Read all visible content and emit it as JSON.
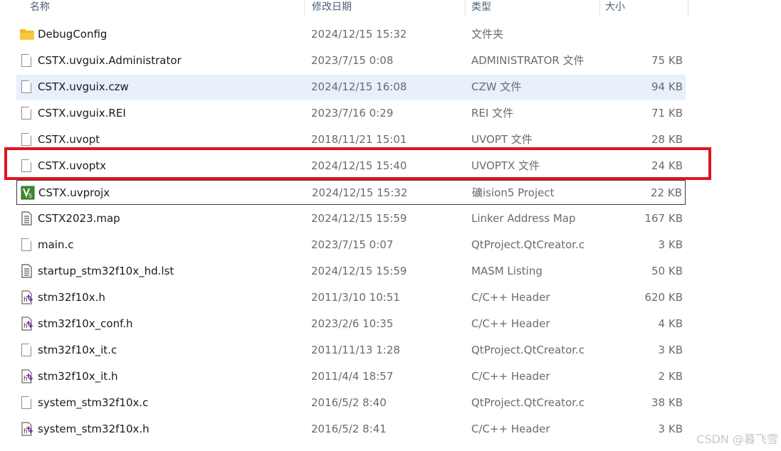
{
  "columns": {
    "name": "名称",
    "date": "修改日期",
    "type": "类型",
    "size": "大小"
  },
  "files": [
    {
      "name": "DebugConfig",
      "date": "2024/12/15 15:32",
      "type": "文件夹",
      "size": "",
      "icon": "folder-icon"
    },
    {
      "name": "CSTX.uvguix.Administrator",
      "date": "2023/7/15 0:08",
      "type": "ADMINISTRATOR 文件",
      "size": "75 KB",
      "icon": "file-icon"
    },
    {
      "name": "CSTX.uvguix.czw",
      "date": "2024/12/15 16:08",
      "type": "CZW 文件",
      "size": "94 KB",
      "icon": "file-icon",
      "selected": true
    },
    {
      "name": "CSTX.uvguix.REI",
      "date": "2023/7/16 0:29",
      "type": "REI 文件",
      "size": "71 KB",
      "icon": "file-icon"
    },
    {
      "name": "CSTX.uvopt",
      "date": "2018/11/21 15:01",
      "type": "UVOPT 文件",
      "size": "28 KB",
      "icon": "file-icon"
    },
    {
      "name": "CSTX.uvoptx",
      "date": "2024/12/15 15:40",
      "type": "UVOPTX 文件",
      "size": "24 KB",
      "icon": "file-icon",
      "highlighted": true
    },
    {
      "name": "CSTX.uvprojx",
      "date": "2024/12/15 15:32",
      "type": "礦ision5 Project",
      "size": "22 KB",
      "icon": "keil-project-icon",
      "focused": true
    },
    {
      "name": "CSTX2023.map",
      "date": "2024/12/15 15:59",
      "type": "Linker Address Map",
      "size": "167 KB",
      "icon": "text-file-icon"
    },
    {
      "name": "main.c",
      "date": "2023/7/15 0:07",
      "type": "QtProject.QtCreator.c",
      "size": "3 KB",
      "icon": "file-icon"
    },
    {
      "name": "startup_stm32f10x_hd.lst",
      "date": "2024/12/15 15:59",
      "type": "MASM Listing",
      "size": "50 KB",
      "icon": "text-file-icon"
    },
    {
      "name": "stm32f10x.h",
      "date": "2011/3/10 10:51",
      "type": "C/C++ Header",
      "size": "620 KB",
      "icon": "header-file-icon"
    },
    {
      "name": "stm32f10x_conf.h",
      "date": "2023/2/6 10:35",
      "type": "C/C++ Header",
      "size": "4 KB",
      "icon": "header-file-icon"
    },
    {
      "name": "stm32f10x_it.c",
      "date": "2011/11/13 1:28",
      "type": "QtProject.QtCreator.c",
      "size": "3 KB",
      "icon": "file-icon"
    },
    {
      "name": "stm32f10x_it.h",
      "date": "2011/4/4 18:57",
      "type": "C/C++ Header",
      "size": "2 KB",
      "icon": "header-file-icon"
    },
    {
      "name": "system_stm32f10x.c",
      "date": "2016/5/2 8:40",
      "type": "QtProject.QtCreator.c",
      "size": "38 KB",
      "icon": "file-icon"
    },
    {
      "name": "system_stm32f10x.h",
      "date": "2016/5/2 8:41",
      "type": "C/C++ Header",
      "size": "3 KB",
      "icon": "header-file-icon"
    }
  ],
  "watermark": "CSDN @暮飞雪",
  "colors": {
    "highlight": "#e0141e",
    "selected_row": "#e7f0fb",
    "folder": "#f2b923",
    "keil": "#3f8a2e",
    "header_icon": "#7a2aa8"
  }
}
